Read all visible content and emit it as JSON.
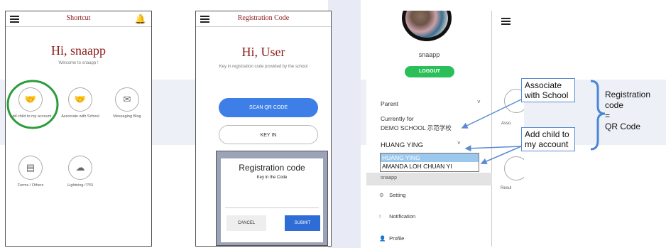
{
  "shortcut": {
    "title": "Shortcut",
    "greeting": "Hi, snaapp",
    "welcome": "Welcome to snaapp !",
    "tiles": [
      {
        "label": "Add child to my account",
        "icon": "handshake-icon"
      },
      {
        "label": "Associate with School",
        "icon": "handshake-icon"
      },
      {
        "label": "Messaging Blog",
        "icon": "message-icon"
      },
      {
        "label": "Forms / Others",
        "icon": "form-icon"
      },
      {
        "label": "Lightning / PSI",
        "icon": "cloud-icon"
      }
    ]
  },
  "registration": {
    "title": "Registration Code",
    "greeting": "Hi, User",
    "instruction": "Key in registration code provided by the school",
    "scan_label": "SCAN QR CODE",
    "keyin_label": "KEY IN",
    "dialog": {
      "title": "Registration code",
      "subtitle": "Key in the Code",
      "cancel": "CANCEL",
      "submit": "SUBMIT"
    }
  },
  "drawer": {
    "username": "snaapp",
    "logout": "LOGOUT",
    "role": "Parent",
    "currently_for_label": "Currently for",
    "school": "DEMO SCHOOL 示范学校",
    "child_selected": "HUANG YING",
    "child_options": [
      "HUANG YING",
      "AMANDA LOH CHUAN YI"
    ],
    "partial_item": "snaapp",
    "menu": [
      {
        "label": "Setting",
        "icon": "gear-icon"
      },
      {
        "label": "Notification",
        "icon": "exclamation-icon"
      },
      {
        "label": "Profile",
        "icon": "person-icon"
      }
    ],
    "right_partial_1": "Asso",
    "right_partial_2": "Resul"
  },
  "annotations": {
    "associate": "Associate with School",
    "add_child": "Add child to my account",
    "reg_eq": [
      "Registration",
      "code",
      "=",
      "QR Code"
    ]
  },
  "colors": {
    "accent_blue": "#3d7fe6",
    "title_red": "#8b1a1a",
    "logout_green": "#2bbf5a",
    "highlight_green": "#2a9d3a"
  }
}
